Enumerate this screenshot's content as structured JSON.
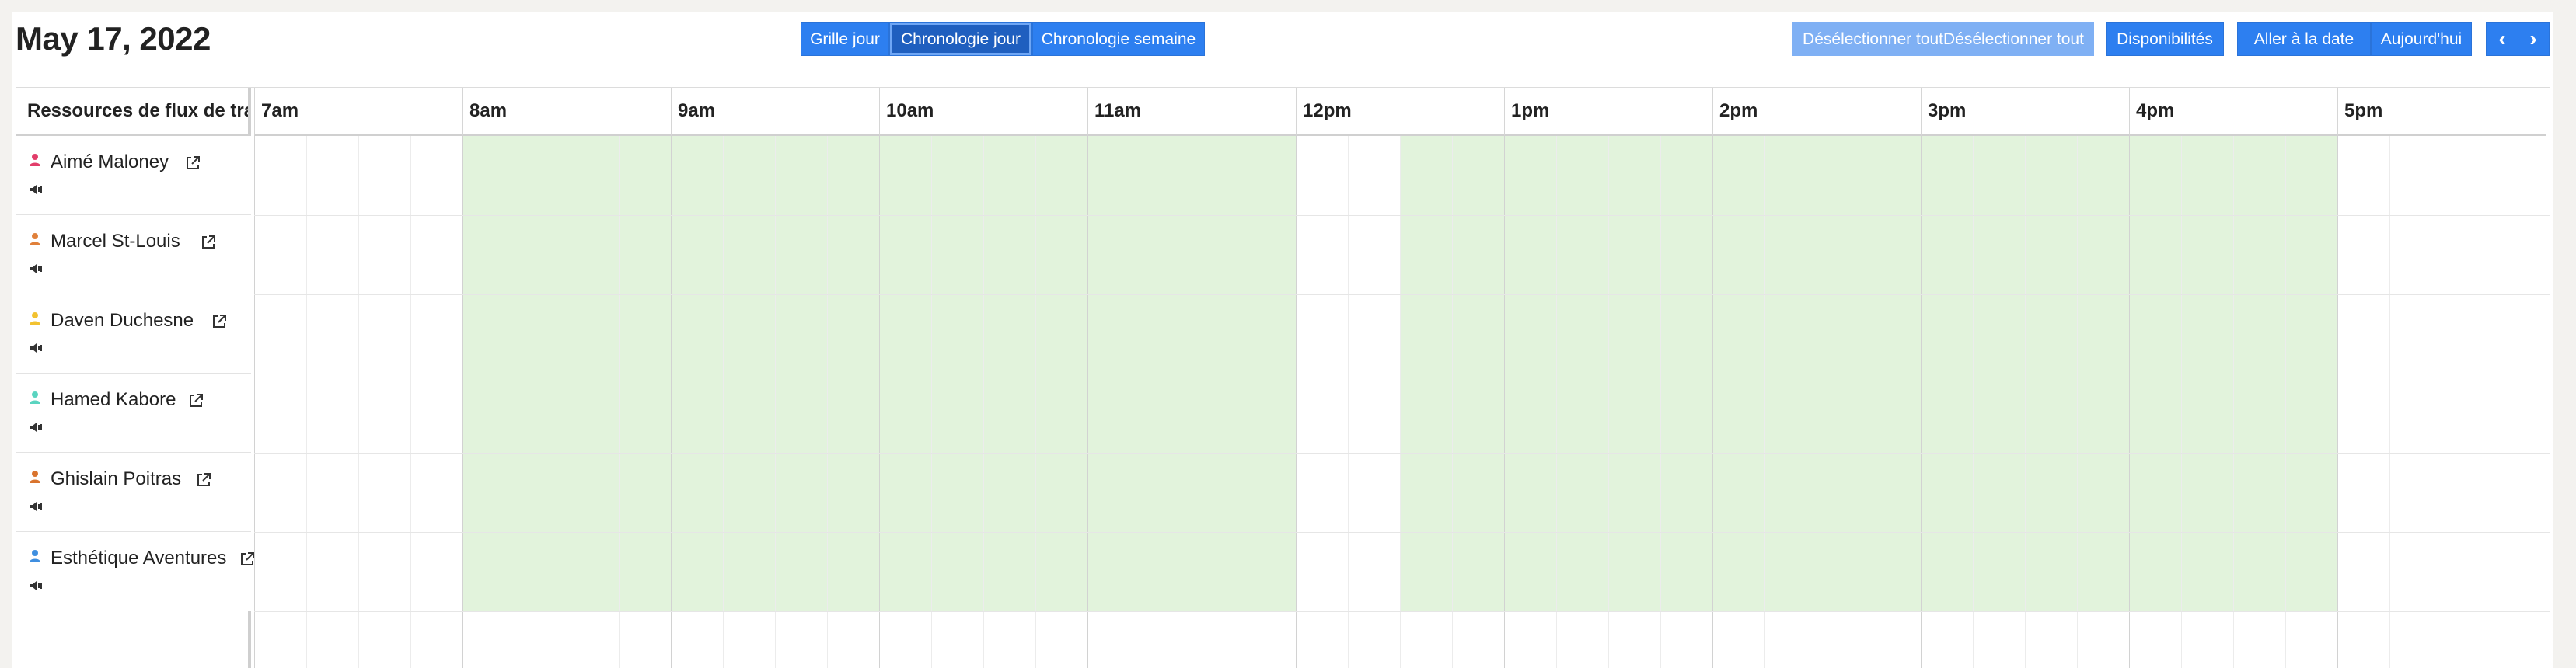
{
  "header": {
    "date": "May 17, 2022"
  },
  "views": [
    {
      "label": "Grille jour",
      "active": false
    },
    {
      "label": "Chronologie jour",
      "active": true
    },
    {
      "label": "Chronologie semaine",
      "active": false
    }
  ],
  "toolbar": {
    "deselect_label": "Désélectionner toutDésélectionner tout",
    "availability_label": "Disponibilités",
    "goto_date_label": "Aller à la date",
    "today_label": "Aujourd'hui",
    "prev_icon": "chevron-left-icon",
    "next_icon": "chevron-right-icon"
  },
  "resources_header": "Ressources de flux de travail",
  "hours": [
    "7am",
    "8am",
    "9am",
    "10am",
    "11am",
    "12pm",
    "1pm",
    "2pm",
    "3pm",
    "4pm",
    "5pm"
  ],
  "resources": [
    {
      "name": "Aimé Maloney",
      "icon_color": "#e23d6a"
    },
    {
      "name": "Marcel St-Louis",
      "icon_color": "#e0803a"
    },
    {
      "name": "Daven Duchesne",
      "icon_color": "#f2c230"
    },
    {
      "name": "Hamed Kabore",
      "icon_color": "#5ad4c0"
    },
    {
      "name": "Ghislain Poitras",
      "icon_color": "#d9742e"
    },
    {
      "name": "Esthétique Aventures",
      "icon_color": "#3f8fe0"
    }
  ],
  "colors": {
    "primary": "#2d7ff0",
    "available": "#e2f3dc"
  }
}
